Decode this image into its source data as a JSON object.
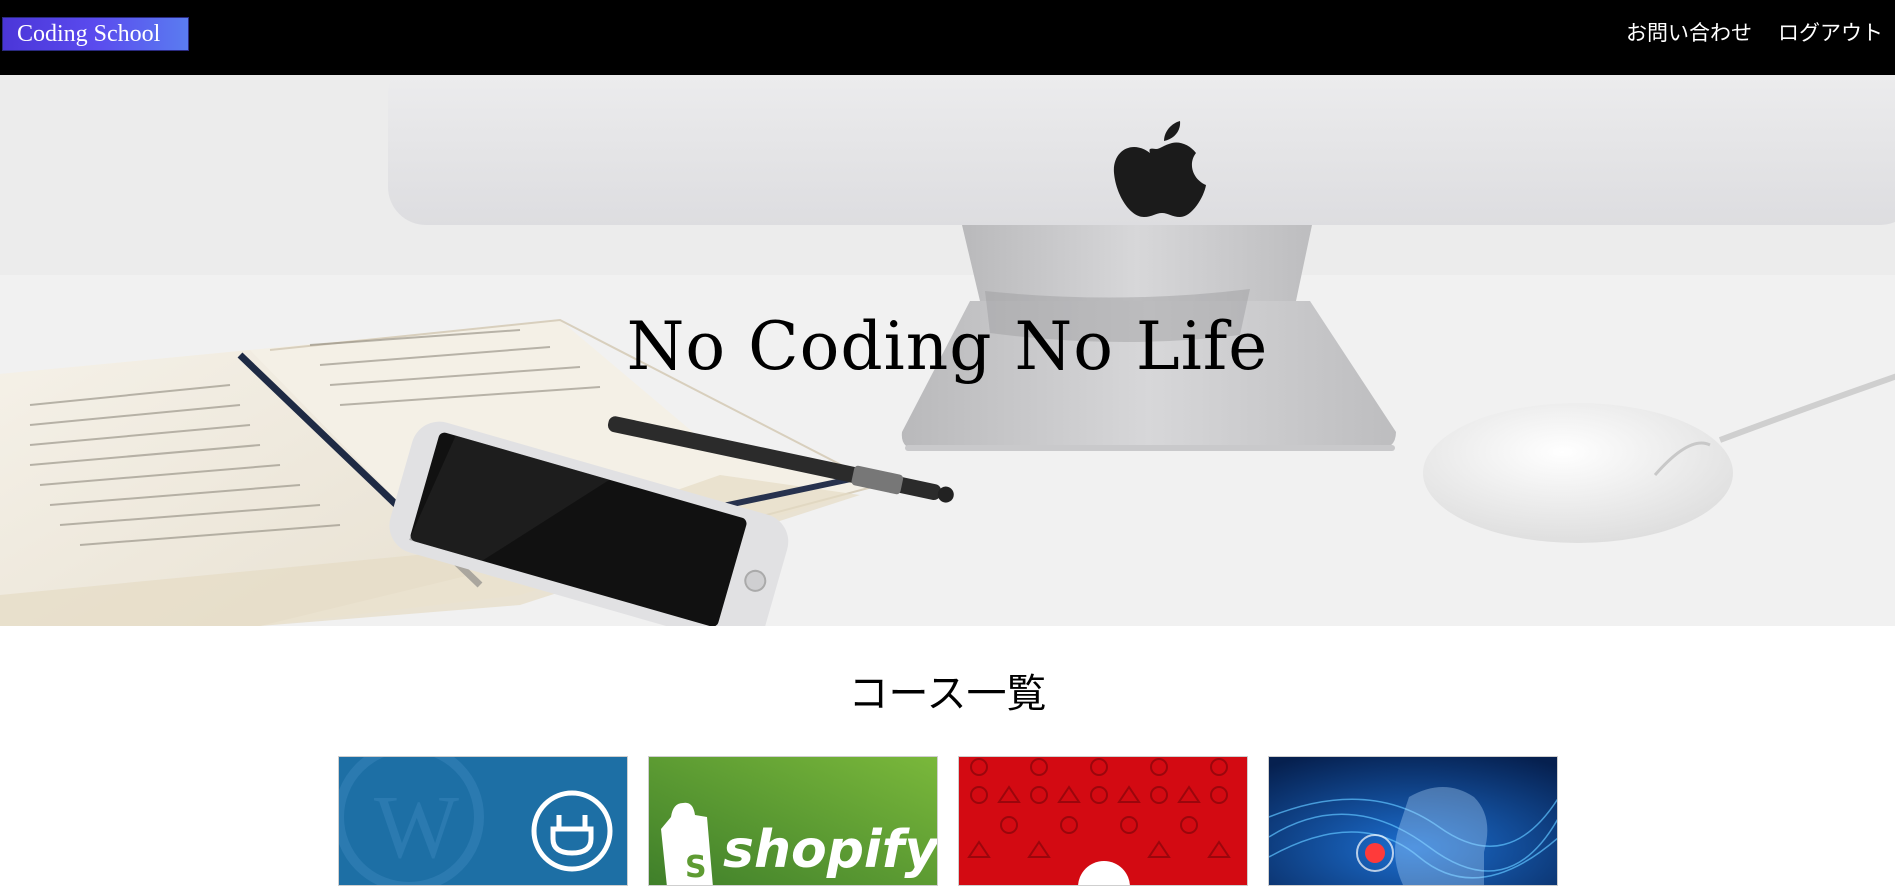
{
  "header": {
    "logo_text": "Coding School",
    "nav": [
      {
        "label": "お問い合わせ"
      },
      {
        "label": "ログアウト"
      }
    ]
  },
  "hero": {
    "title": "No Coding No Life"
  },
  "courses": {
    "title": "コース一覧",
    "cards": [
      {
        "thumbnail_text": "",
        "icon": "wordpress-plugin-icon",
        "color": "#1d6fa5"
      },
      {
        "thumbnail_text": "shopify",
        "icon": "shopify-bag-icon",
        "color": "#5e9b32"
      },
      {
        "thumbnail_text": "",
        "icon": "warning-pattern-icon",
        "color": "#d30a12"
      },
      {
        "thumbnail_text": "",
        "icon": "ai-head-icon",
        "color": "#0b2e6f"
      }
    ]
  },
  "colors": {
    "topbar": "#000000",
    "logo_gradient_start": "#4b36d8",
    "logo_gradient_end": "#5a7cf0"
  }
}
